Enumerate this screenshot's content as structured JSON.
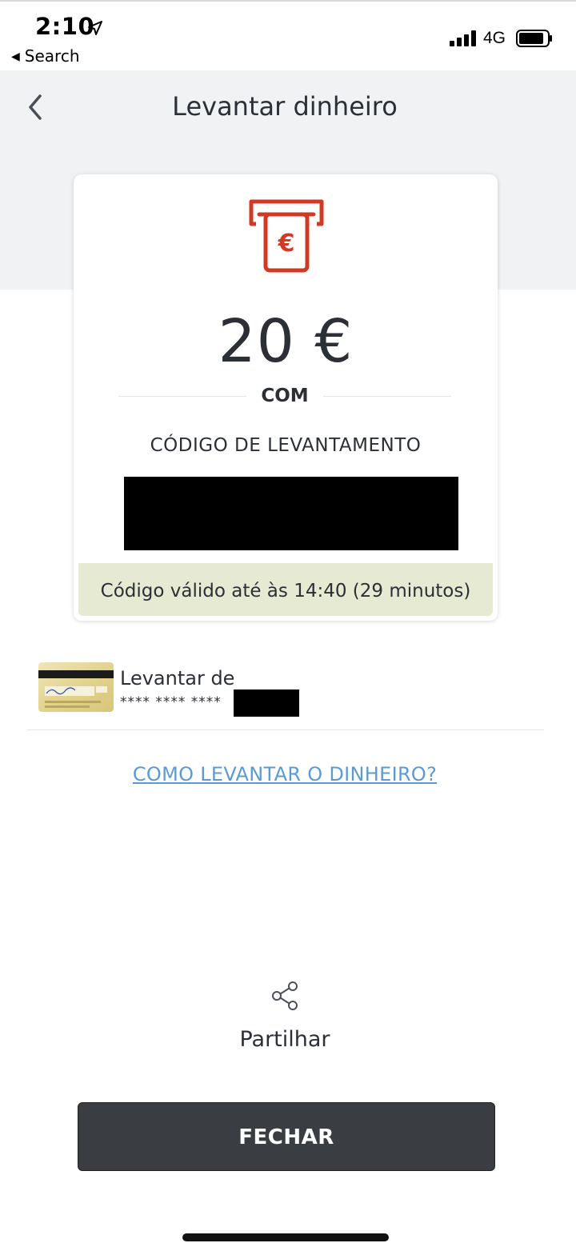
{
  "status_bar": {
    "time": "2:10",
    "back_app_label": "Search",
    "network": "4G"
  },
  "header": {
    "title": "Levantar dinheiro"
  },
  "withdrawal_card": {
    "amount": "20 €",
    "method": "COM",
    "code_label": "CÓDIGO DE LEVANTAMENTO",
    "validity": "Código válido até às 14:40 (29 minutos)"
  },
  "source_card": {
    "title": "Levantar de",
    "number_masked": "**** **** ****"
  },
  "links": {
    "how_to": "COMO LEVANTAR O DINHEIRO?"
  },
  "share": {
    "label": "Partilhar"
  },
  "actions": {
    "close_label": "FECHAR"
  },
  "colors": {
    "accent_red": "#d03a24",
    "link_blue": "#5b9bd5",
    "validity_bg": "#e6ead3",
    "button_bg": "#3a3d41"
  },
  "icons": {
    "nav_back": "chevron-left-icon",
    "atm": "atm-euro-icon",
    "share": "share-icon",
    "location": "location-arrow-icon"
  }
}
